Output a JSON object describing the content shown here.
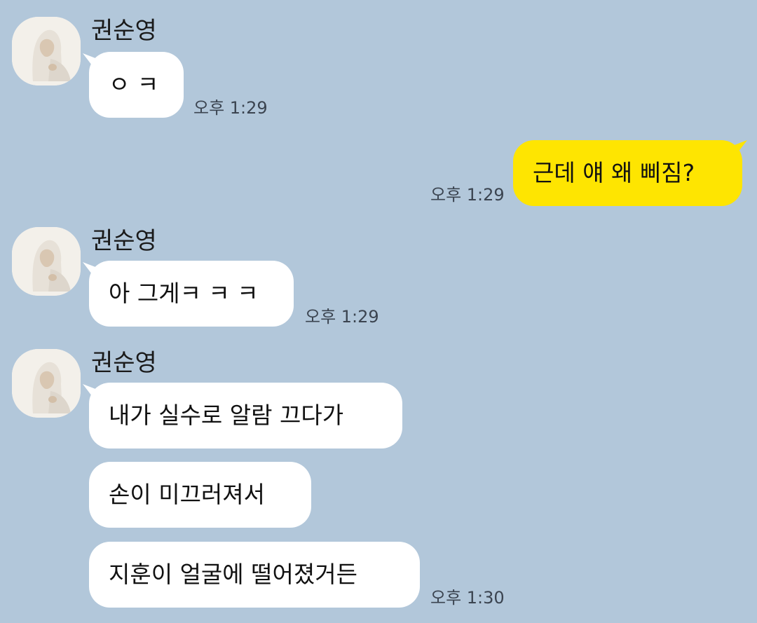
{
  "chat": {
    "groups": [
      {
        "sender": "권순영",
        "messages": [
          {
            "text": "ㅇ ㅋ",
            "time": "오후 1:29"
          }
        ]
      },
      {
        "sender": "me",
        "messages": [
          {
            "text": "근데 얘 왜 삐짐?",
            "time": "오후 1:29"
          }
        ]
      },
      {
        "sender": "권순영",
        "messages": [
          {
            "text": "아 그게ㅋ ㅋ ㅋ",
            "time": "오후 1:29"
          }
        ]
      },
      {
        "sender": "권순영",
        "messages": [
          {
            "text": "내가 실수로 알람 끄다가"
          },
          {
            "text": "손이 미끄러져서"
          },
          {
            "text": "지훈이 얼굴에 떨어졌거든",
            "time": "오후 1:30"
          }
        ]
      }
    ]
  },
  "colors": {
    "background": "#b2c7da",
    "incoming_bubble": "#ffffff",
    "outgoing_bubble": "#fee501"
  },
  "icons": {
    "avatar": "profile-photo-hooded-figure"
  }
}
